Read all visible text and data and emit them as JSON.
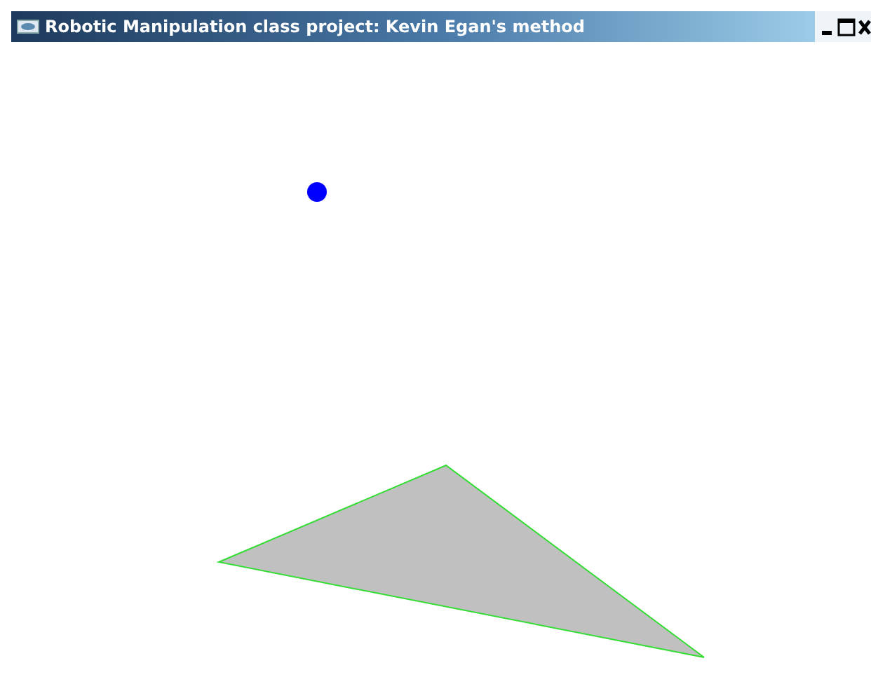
{
  "window": {
    "title": "Robotic Manipulation class project: Kevin Egan's method"
  }
}
